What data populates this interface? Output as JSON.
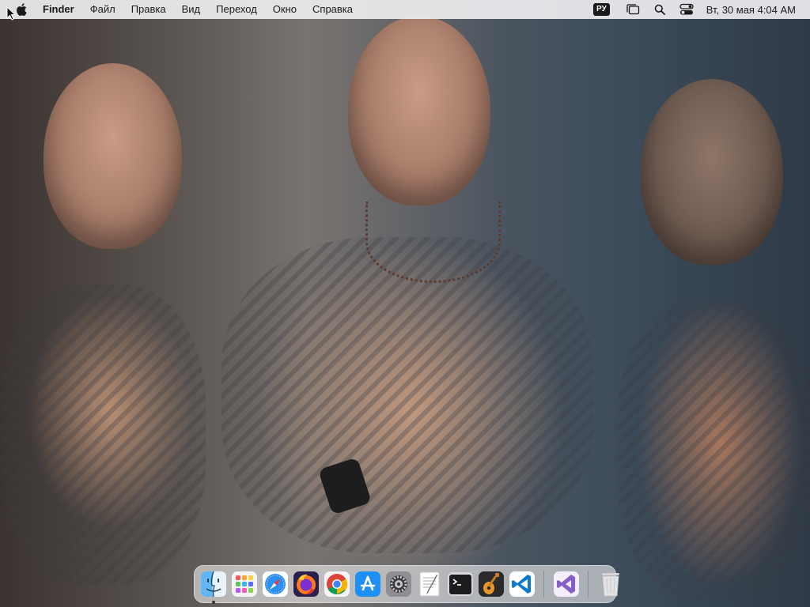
{
  "menubar": {
    "apple_icon": "apple-icon",
    "app_name": "Finder",
    "menus": [
      "Файл",
      "Правка",
      "Вид",
      "Переход",
      "Окно",
      "Справка"
    ],
    "input_language": "РУ",
    "status_icons": [
      "stage-manager-icon",
      "spotlight-search-icon",
      "control-center-icon"
    ],
    "clock": "Вт, 30 мая  4:04 AM"
  },
  "dock": {
    "apps": [
      {
        "name": "finder",
        "icon": "finder-icon",
        "running": true
      },
      {
        "name": "launchpad",
        "icon": "launchpad-icon",
        "running": false
      },
      {
        "name": "safari",
        "icon": "safari-icon",
        "running": false
      },
      {
        "name": "firefox",
        "icon": "firefox-icon",
        "running": false
      },
      {
        "name": "chrome",
        "icon": "chrome-icon",
        "running": false
      },
      {
        "name": "app-store",
        "icon": "app-store-icon",
        "running": false
      },
      {
        "name": "system-settings",
        "icon": "system-settings-icon",
        "running": false
      },
      {
        "name": "textedit",
        "icon": "textedit-icon",
        "running": false
      },
      {
        "name": "terminal",
        "icon": "terminal-icon",
        "running": false
      },
      {
        "name": "garageband",
        "icon": "garageband-icon",
        "running": false
      },
      {
        "name": "vscode",
        "icon": "vscode-icon",
        "running": false
      }
    ],
    "recent_apps": [
      {
        "name": "visual-studio",
        "icon": "visual-studio-icon",
        "running": false
      }
    ],
    "trash": {
      "name": "trash",
      "icon": "trash-icon"
    }
  },
  "colors": {
    "menubar_bg": "#ececee",
    "dock_bg": "#ebebee",
    "vscode_blue": "#0a7acc",
    "visual_studio_purple": "#8661c5"
  }
}
